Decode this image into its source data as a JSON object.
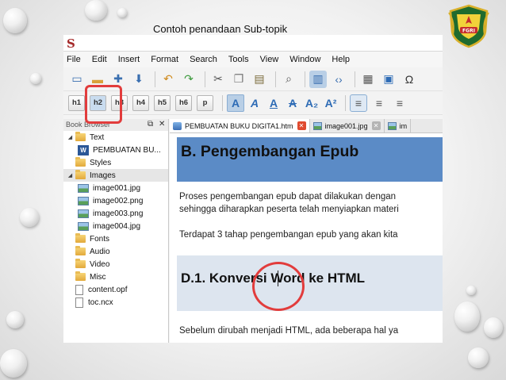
{
  "slide": {
    "title": "Contoh penandaan Sub-topik",
    "logo_text": "FGRI"
  },
  "app": {
    "icon_letter": "S",
    "menu": [
      "File",
      "Edit",
      "Insert",
      "Format",
      "Search",
      "Tools",
      "View",
      "Window",
      "Help"
    ],
    "heading_buttons": [
      "h1",
      "h2",
      "h3",
      "h4",
      "h5",
      "h6",
      "p"
    ],
    "format_buttons": [
      "A",
      "A",
      "A",
      "A",
      "A₂",
      "A²"
    ],
    "book_browser_title": "Book Browser",
    "tree": [
      {
        "label": "Text",
        "type": "folder",
        "level": 0
      },
      {
        "label": "PEMBUATAN BU...",
        "type": "word",
        "level": 1
      },
      {
        "label": "Styles",
        "type": "folder",
        "level": 0
      },
      {
        "label": "Images",
        "type": "folder",
        "level": 0,
        "selected": true
      },
      {
        "label": "image001.jpg",
        "type": "image",
        "level": 1
      },
      {
        "label": "image002.png",
        "type": "image",
        "level": 1
      },
      {
        "label": "image003.png",
        "type": "image",
        "level": 1
      },
      {
        "label": "image004.jpg",
        "type": "image",
        "level": 1
      },
      {
        "label": "Fonts",
        "type": "folder",
        "level": 0
      },
      {
        "label": "Audio",
        "type": "folder",
        "level": 0
      },
      {
        "label": "Video",
        "type": "folder",
        "level": 0
      },
      {
        "label": "Misc",
        "type": "folder",
        "level": 0
      },
      {
        "label": "content.opf",
        "type": "doc",
        "level": 0
      },
      {
        "label": "toc.ncx",
        "type": "doc",
        "level": 0
      }
    ],
    "tabs": [
      {
        "label": "PEMBUATAN BUKU DIGITA1.htm",
        "active": true
      },
      {
        "label": "image001.jpg",
        "active": false
      },
      {
        "label": "im",
        "active": false
      }
    ],
    "doc": {
      "heading": "B.  Pengembangan Epub",
      "para1_line1": "Proses pengembangan epub dapat dilakukan dengan",
      "para1_line2": "sehingga diharapkan peserta telah menyiapkan materi",
      "para2": "Terdapat 3 tahap pengembangan epub yang akan kita",
      "subheading": "D.1.   Konversi Word ke HTML",
      "para3": "Sebelum dirubah menjadi HTML, ada beberapa hal ya"
    }
  },
  "colors": {
    "highlight_red": "#e23c3c",
    "heading_bg": "#5b8bc6",
    "subheading_bg": "#dde5ef"
  }
}
